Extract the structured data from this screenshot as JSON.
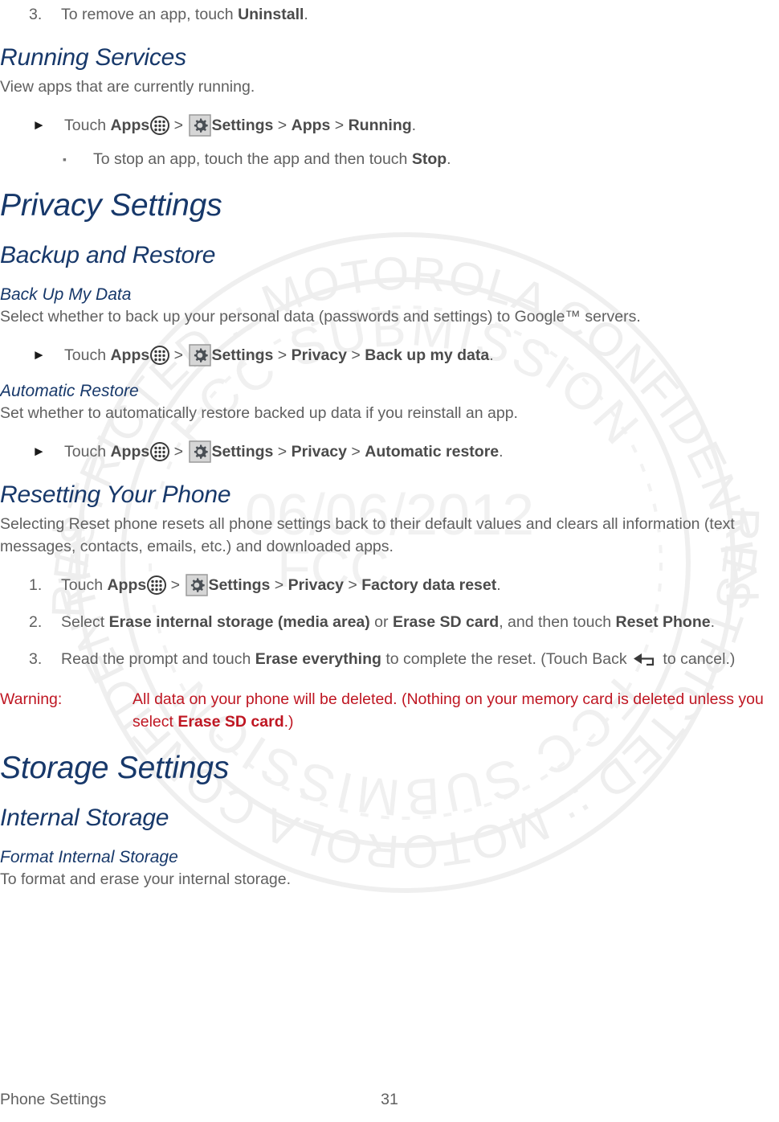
{
  "document": {
    "type": "user-guide-page",
    "colors": {
      "heading": "#17386a",
      "body": "#606060",
      "bold": "#4b4b4b",
      "warning": "#bf1622",
      "watermark": "#eeeeee"
    }
  },
  "watermark": {
    "outer_arc_top": "RESTRICTED :: MOTOROLA CONFIDENTIAL",
    "inner_arc_top": "FCC SUBMISSION",
    "outer_arc_bottom": "RESTRICTED :: MOTOROLA CONFIDENTIAL",
    "inner_arc_bottom": "FCC SUBMISSION",
    "center_date": "06/06/2012",
    "center_label": "FCC"
  },
  "step_top": {
    "number": "3.",
    "text_before": "To remove an app, touch ",
    "bold": "Uninstall",
    "text_after": "."
  },
  "sections": [
    {
      "id": "running-services",
      "heading": "Running Services",
      "heading_level": "h2",
      "paragraph": "View apps that are currently running.",
      "steps": [
        {
          "type": "arrow",
          "marker": "►",
          "parts": [
            {
              "t": "plain",
              "v": "Touch "
            },
            {
              "t": "bold",
              "v": "Apps"
            },
            {
              "t": "icon",
              "v": "apps-icon"
            },
            {
              "t": "gt",
              "v": " > "
            },
            {
              "t": "icon",
              "v": "gear-icon"
            },
            {
              "t": "bold",
              "v": "Settings"
            },
            {
              "t": "gt",
              "v": " > "
            },
            {
              "t": "bold",
              "v": "Apps"
            },
            {
              "t": "gt",
              "v": " > "
            },
            {
              "t": "bold",
              "v": "Running"
            },
            {
              "t": "plain",
              "v": "."
            }
          ]
        },
        {
          "type": "sub",
          "marker": "▪",
          "parts": [
            {
              "t": "plain",
              "v": "To stop an app, touch the app and then touch "
            },
            {
              "t": "bold",
              "v": "Stop"
            },
            {
              "t": "plain",
              "v": "."
            }
          ]
        }
      ]
    },
    {
      "id": "privacy-settings",
      "heading": "Privacy Settings",
      "heading_level": "h1"
    },
    {
      "id": "backup-and-restore",
      "heading": "Backup and Restore",
      "heading_level": "h2"
    },
    {
      "id": "back-up-my-data",
      "heading": "Back Up My Data",
      "heading_level": "h3",
      "paragraph": "Select whether to back up your personal data (passwords and settings) to Google™ servers.",
      "steps": [
        {
          "type": "arrow",
          "marker": "►",
          "parts": [
            {
              "t": "plain",
              "v": "Touch "
            },
            {
              "t": "bold",
              "v": "Apps"
            },
            {
              "t": "icon",
              "v": "apps-icon"
            },
            {
              "t": "gt",
              "v": " > "
            },
            {
              "t": "icon",
              "v": "gear-icon"
            },
            {
              "t": "bold",
              "v": "Settings"
            },
            {
              "t": "gt",
              "v": " > "
            },
            {
              "t": "bold",
              "v": "Privacy"
            },
            {
              "t": "gt",
              "v": " > "
            },
            {
              "t": "bold",
              "v": "Back up my data"
            },
            {
              "t": "plain",
              "v": "."
            }
          ]
        }
      ]
    },
    {
      "id": "automatic-restore",
      "heading": "Automatic Restore",
      "heading_level": "h3",
      "paragraph": "Set whether to automatically restore backed up data if you reinstall an app.",
      "steps": [
        {
          "type": "arrow",
          "marker": "►",
          "parts": [
            {
              "t": "plain",
              "v": "Touch "
            },
            {
              "t": "bold",
              "v": "Apps"
            },
            {
              "t": "icon",
              "v": "apps-icon"
            },
            {
              "t": "gt",
              "v": " > "
            },
            {
              "t": "icon",
              "v": "gear-icon"
            },
            {
              "t": "bold",
              "v": "Settings"
            },
            {
              "t": "gt",
              "v": " > "
            },
            {
              "t": "bold",
              "v": "Privacy"
            },
            {
              "t": "gt",
              "v": " > "
            },
            {
              "t": "bold",
              "v": "Automatic restore"
            },
            {
              "t": "plain",
              "v": "."
            }
          ]
        }
      ]
    },
    {
      "id": "resetting-your-phone",
      "heading": "Resetting Your Phone",
      "heading_level": "h2",
      "paragraph": "Selecting Reset phone resets all phone settings back to their default values and clears all information (text messages, contacts, emails, etc.) and downloaded apps.",
      "steps": [
        {
          "type": "num",
          "marker": "1.",
          "parts": [
            {
              "t": "plain",
              "v": "Touch "
            },
            {
              "t": "bold",
              "v": "Apps"
            },
            {
              "t": "icon",
              "v": "apps-icon"
            },
            {
              "t": "gt",
              "v": " > "
            },
            {
              "t": "icon",
              "v": "gear-icon"
            },
            {
              "t": "bold",
              "v": "Settings"
            },
            {
              "t": "gt",
              "v": " > "
            },
            {
              "t": "bold",
              "v": "Privacy"
            },
            {
              "t": "gt",
              "v": " > "
            },
            {
              "t": "bold",
              "v": "Factory data reset"
            },
            {
              "t": "plain",
              "v": "."
            }
          ]
        },
        {
          "type": "num",
          "marker": "2.",
          "parts": [
            {
              "t": "plain",
              "v": "Select "
            },
            {
              "t": "bold",
              "v": "Erase internal storage (media area)"
            },
            {
              "t": "plain",
              "v": " or "
            },
            {
              "t": "bold",
              "v": "Erase SD card"
            },
            {
              "t": "plain",
              "v": ", and then touch "
            },
            {
              "t": "bold",
              "v": "Reset Phone"
            },
            {
              "t": "plain",
              "v": "."
            }
          ]
        },
        {
          "type": "num",
          "marker": "3.",
          "parts": [
            {
              "t": "plain",
              "v": "Read the prompt and touch "
            },
            {
              "t": "bold",
              "v": "Erase everything"
            },
            {
              "t": "plain",
              "v": " to complete the reset. (Touch Back "
            },
            {
              "t": "icon",
              "v": "back-icon"
            },
            {
              "t": "plain",
              "v": " to cancel.)"
            }
          ]
        }
      ]
    }
  ],
  "warning": {
    "label": "Warning:",
    "parts": [
      {
        "t": "plain",
        "v": "All data on your phone will be deleted. (Nothing on your memory card is deleted unless you select "
      },
      {
        "t": "bold",
        "v": "Erase SD card"
      },
      {
        "t": "plain",
        "v": ".)"
      }
    ]
  },
  "sections_tail": [
    {
      "id": "storage-settings",
      "heading": "Storage Settings",
      "heading_level": "h1"
    },
    {
      "id": "internal-storage",
      "heading": "Internal Storage",
      "heading_level": "h2"
    },
    {
      "id": "format-internal-storage",
      "heading": "Format Internal Storage",
      "heading_level": "h3",
      "paragraph": "To format and erase your internal storage."
    }
  ],
  "footer": {
    "left": "Phone Settings",
    "page_number": "31"
  },
  "icons": {
    "apps": "apps-grid-icon",
    "settings": "gear-icon",
    "back": "back-arrow-icon"
  }
}
